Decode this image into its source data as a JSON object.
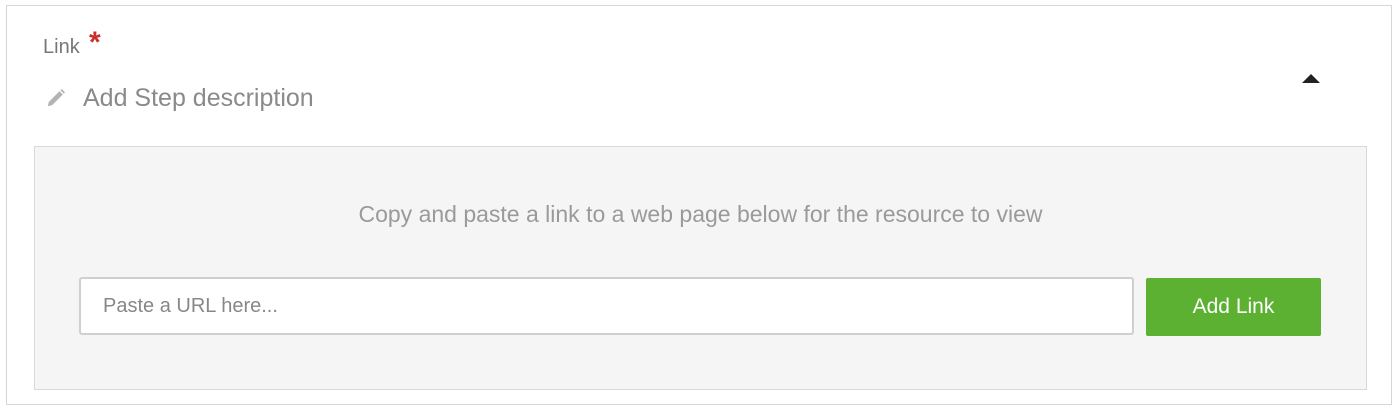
{
  "field": {
    "label": "Link",
    "required_marker": "*",
    "description_placeholder": "Add Step description",
    "description_icon": "pencil-icon",
    "toggle_icon": "caret-up-icon"
  },
  "link_panel": {
    "instruction": "Copy and paste a link to a web page below for the resource to view",
    "url_input": {
      "value": "",
      "placeholder": "Paste a URL here..."
    },
    "add_button_label": "Add Link"
  },
  "colors": {
    "accent_green": "#5cb132",
    "required_red": "#c9302c",
    "panel_background": "#f5f5f5"
  }
}
